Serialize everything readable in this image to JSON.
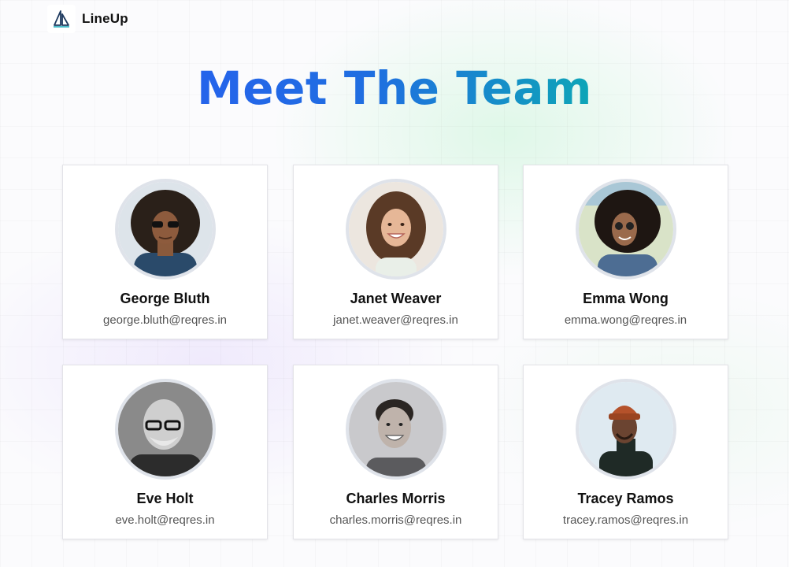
{
  "brand": {
    "name": "LineUp",
    "logo_icon": "sail-logo-icon"
  },
  "page": {
    "title": "Meet The Team"
  },
  "team": [
    {
      "name": "George Bluth",
      "email": "george.bluth@reqres.in"
    },
    {
      "name": "Janet Weaver",
      "email": "janet.weaver@reqres.in"
    },
    {
      "name": "Emma Wong",
      "email": "emma.wong@reqres.in"
    },
    {
      "name": "Eve Holt",
      "email": "eve.holt@reqres.in"
    },
    {
      "name": "Charles Morris",
      "email": "charles.morris@reqres.in"
    },
    {
      "name": "Tracey Ramos",
      "email": "tracey.ramos@reqres.in"
    }
  ],
  "colors": {
    "title_gradient_start": "#2563eb",
    "title_gradient_end": "#0ea5b7",
    "card_border": "#e3e3e8",
    "avatar_ring": "#dfe3ea"
  }
}
